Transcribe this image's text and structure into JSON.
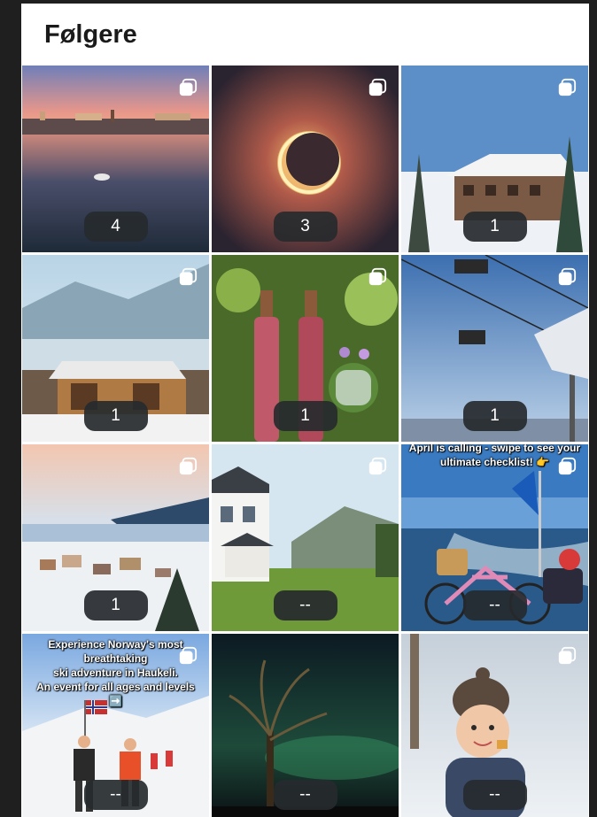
{
  "header": {
    "title": "Følgere"
  },
  "tiles": [
    {
      "count": "4"
    },
    {
      "count": "3"
    },
    {
      "count": "1"
    },
    {
      "count": "1"
    },
    {
      "count": "1"
    },
    {
      "count": "1"
    },
    {
      "count": "1"
    },
    {
      "count": "--"
    },
    {
      "count": "--",
      "caption": [
        "April is calling - swipe to see your",
        "ultimate checklist! 👉"
      ]
    },
    {
      "count": "--",
      "caption": [
        "Experience Norway's most breathtaking",
        "ski adventure in Haukeli.",
        "An event for all ages and levels ➡️"
      ]
    },
    {
      "count": "--"
    },
    {
      "count": "--"
    }
  ],
  "icons": {
    "carousel": "multiple-images-icon"
  }
}
